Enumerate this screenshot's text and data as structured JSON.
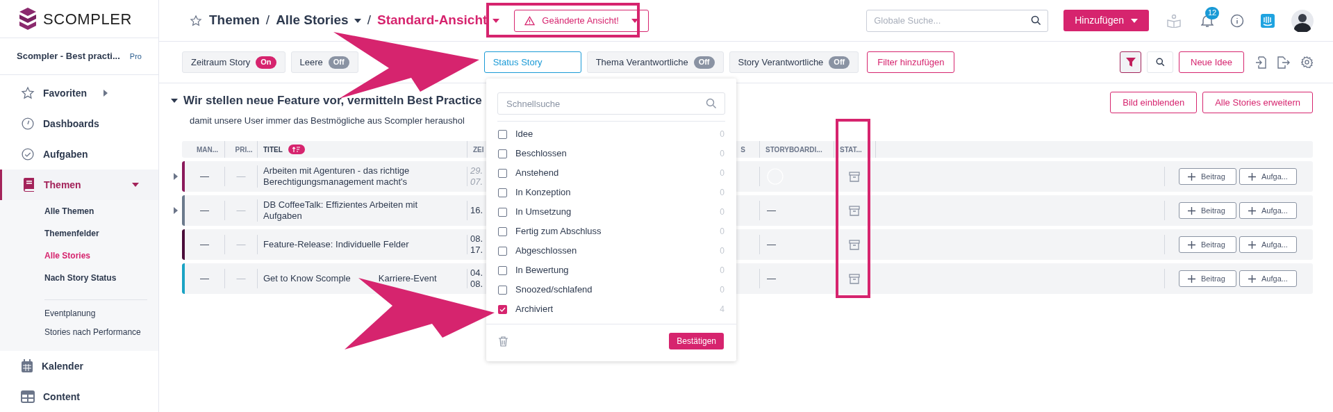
{
  "logo": {
    "text": "SCOMPLER"
  },
  "workspace": {
    "name": "Scompler - Best practi...",
    "plan": "Pro"
  },
  "nav": [
    {
      "label": "Favoriten",
      "expanded": false,
      "selected": false
    },
    {
      "label": "Dashboards",
      "selected": false
    },
    {
      "label": "Aufgaben",
      "selected": false
    },
    {
      "label": "Themen",
      "expanded": true,
      "selected": true,
      "children": [
        {
          "label": "Alle Themen",
          "selected": false
        },
        {
          "label": "Themenfelder",
          "selected": false
        },
        {
          "label": "Alle Stories",
          "selected": true
        },
        {
          "label": "Nach Story Status",
          "selected": false
        }
      ],
      "extra_links": [
        "Eventplanung",
        "Stories nach Performance"
      ]
    },
    {
      "label": "Kalender",
      "selected": false
    },
    {
      "label": "Content",
      "selected": false
    }
  ],
  "breadcrumb": [
    {
      "label": "Themen",
      "dropdown": false
    },
    {
      "separator": "/",
      "label": "Alle Stories",
      "dropdown": true
    },
    {
      "separator": "/",
      "label": "Standard-Ansicht",
      "dropdown": true
    }
  ],
  "changed_view_button": "Geänderte Ansicht!",
  "search": {
    "placeholder": "Globale Suche..."
  },
  "add_button": "Hinzufügen",
  "notifications": {
    "count": "12"
  },
  "filters": [
    {
      "kind": "toggle",
      "label": "Zeitraum Story",
      "toggle": "On",
      "on": true
    },
    {
      "kind": "toggle",
      "label": "Leere",
      "toggle": "Off",
      "on": false
    },
    {
      "kind": "active",
      "label": "Status Story"
    },
    {
      "kind": "toggle",
      "label": "Thema Verantwortliche",
      "toggle": "Off",
      "on": false
    },
    {
      "kind": "toggle",
      "label": "Story Verantwortliche",
      "toggle": "Off",
      "on": false
    }
  ],
  "add_filter_button": "Filter hinzufügen",
  "filter_toggle": {
    "on": true
  },
  "new_idea_button": "Neue Idee",
  "section": {
    "expanded": true,
    "title": "Wir stellen neue Feature vor, vermitteln Best Practice",
    "subtitle": "damit unsere User immer das Bestmögliche aus Scompler heraushol",
    "buttons": [
      "Bild einblenden",
      "Alle Stories erweitern"
    ]
  },
  "table": {
    "columns": [
      {
        "label": "MAN...",
        "sorted": false
      },
      {
        "label": "PRI...",
        "sorted": false
      },
      {
        "label": "TITEL",
        "sorted": true
      },
      {
        "label": "ZEI",
        "sorted": false
      },
      {
        "label": "S",
        "sorted": false
      },
      {
        "label": "STORYBOARDI...",
        "sorted": false
      },
      {
        "label": "STAT...",
        "sorted": false
      }
    ],
    "rows": [
      {
        "color": "#8b1a5c",
        "expandable": true,
        "manager": "—",
        "priority": "—",
        "title": [
          "Arbeiten mit Agenturen - das richtige Berechtigungsmanagement macht's"
        ],
        "dates": [
          "29.",
          "07."
        ],
        "dates_muted": true,
        "storyboarding": {
          "kind": "circle"
        },
        "actions": [
          "Beitrag",
          "Aufga..."
        ]
      },
      {
        "color": "#6b7a8c",
        "expandable": true,
        "manager": "—",
        "priority": "—",
        "title": [
          "DB CoffeeTalk: Effizientes Arbeiten mit Aufgaben"
        ],
        "dates": [
          "16."
        ],
        "dates_muted": false,
        "storyboarding": {
          "kind": "text",
          "text": "—"
        },
        "actions": [
          "Beitrag",
          "Aufga..."
        ]
      },
      {
        "color": "#4a0d3a",
        "expandable": false,
        "manager": "—",
        "priority": "—",
        "title": [
          "Feature-Release: Individuelle Felder"
        ],
        "dates": [
          "08.",
          "17."
        ],
        "dates_muted": false,
        "storyboarding": {
          "kind": "text",
          "text": "—"
        },
        "actions": [
          "Beitrag",
          "Aufga..."
        ]
      },
      {
        "color": "#1aa3c4",
        "expandable": false,
        "manager": "—",
        "priority": "—",
        "title": [
          "Get to Know Scomple",
          "Karriere-Event"
        ],
        "dates": [
          "04.",
          "08."
        ],
        "dates_muted": false,
        "storyboarding": {
          "kind": "text",
          "text": "—"
        },
        "actions": [
          "Beitrag",
          "Aufga..."
        ]
      }
    ]
  },
  "status_dropdown": {
    "placeholder": "Schnellsuche",
    "options": [
      {
        "label": "Idee",
        "count": "0",
        "checked": false
      },
      {
        "label": "Beschlossen",
        "count": "0",
        "checked": false
      },
      {
        "label": "Anstehend",
        "count": "0",
        "checked": false
      },
      {
        "label": "In Konzeption",
        "count": "0",
        "checked": false
      },
      {
        "label": "In Umsetzung",
        "count": "0",
        "checked": false
      },
      {
        "label": "Fertig zum Abschluss",
        "count": "0",
        "checked": false
      },
      {
        "label": "Abgeschlossen",
        "count": "0",
        "checked": false
      },
      {
        "label": "In Bewertung",
        "count": "0",
        "checked": false
      },
      {
        "label": "Snoozed/schlafend",
        "count": "0",
        "checked": false
      },
      {
        "label": "Archiviert",
        "count": "4",
        "checked": true
      }
    ],
    "confirm_button": "Bestätigen"
  }
}
